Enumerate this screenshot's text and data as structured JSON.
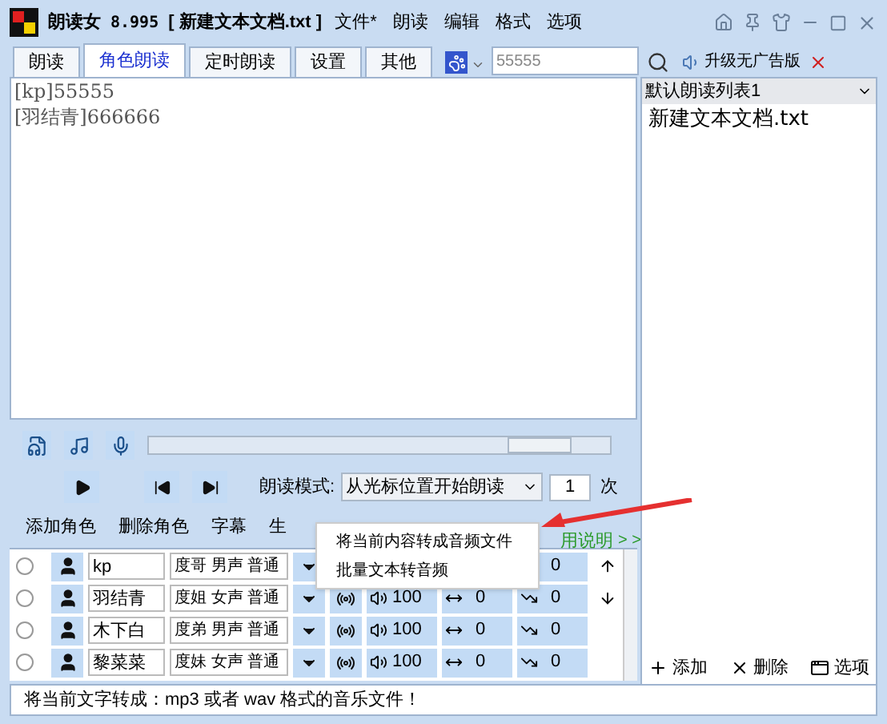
{
  "window": {
    "app_name": "朗读女",
    "version": "8.995",
    "document": "[ 新建文本文档.txt ]"
  },
  "menu": [
    "文件*",
    "朗读",
    "编辑",
    "格式",
    "选项"
  ],
  "tabs": [
    {
      "label": "朗读",
      "selected": false
    },
    {
      "label": "角色朗读",
      "selected": true
    },
    {
      "label": "定时朗读",
      "selected": false
    },
    {
      "label": "设置",
      "selected": false
    },
    {
      "label": "其他",
      "selected": false
    }
  ],
  "search": {
    "value": "55555"
  },
  "upgrade": {
    "label": "升级无广告版"
  },
  "editor": {
    "lines": [
      "[kp]55555",
      "[羽结青]666666"
    ]
  },
  "playlist": {
    "name": "默认朗读列表1",
    "items": [
      "新建文本文档.txt"
    ],
    "buttons": [
      "添加",
      "删除",
      "选项"
    ]
  },
  "position": {
    "level": 0.86
  },
  "mode": {
    "label": "朗读模式:",
    "value": "从光标位置开始朗读",
    "count": "1",
    "unit": "次"
  },
  "toolbar": [
    "添加角色",
    "删除角色",
    "字幕",
    "生"
  ],
  "help_link": "用说明",
  "more": "> >",
  "popup_menu": [
    "将当前内容转成音频文件",
    "批量文本转音频"
  ],
  "roles": [
    {
      "selected": false,
      "name": "kp",
      "voice": "度哥 男声 普通",
      "pitch": "0"
    },
    {
      "selected": false,
      "name": "羽结青",
      "voice": "度姐 女声 普通",
      "volume": "100",
      "rate": "0",
      "pitch": "0"
    },
    {
      "selected": false,
      "name": "木下白",
      "voice": "度弟 男声 普通",
      "volume": "100",
      "rate": "0",
      "pitch": "0"
    },
    {
      "selected": false,
      "name": "黎菜菜",
      "voice": "度妹 女声 普通",
      "volume": "100",
      "rate": "0",
      "pitch": "0"
    }
  ],
  "status": "将当前文字转成：mp3 或者 wav 格式的音乐文件！"
}
